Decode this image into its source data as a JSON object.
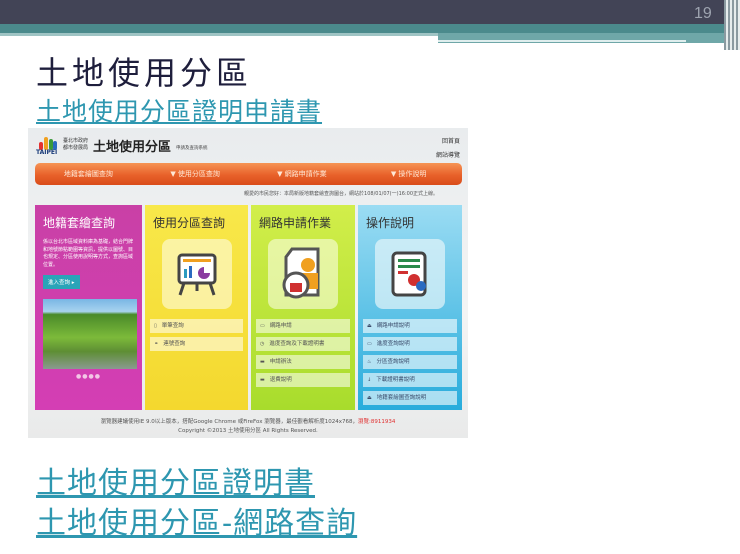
{
  "slide": {
    "page_number": "19",
    "title": "土地使用分區",
    "link_top": "土地使用分區證明申請書",
    "links_bottom": [
      "土地使用分區證明書",
      "土地使用分區-網路查詢"
    ]
  },
  "site": {
    "logo_text": "TAIPEI",
    "org_lines": [
      "臺北市政府",
      "都市發展局"
    ],
    "app_title": "土地使用分區",
    "app_subtitle": "申請及查詢系統",
    "top_links": [
      "回首頁",
      "網站導覽"
    ],
    "nav": [
      "地籍套繪圖查詢",
      "▼ 使用分區查詢",
      "▼ 網路申請作業",
      "▼ 操作說明"
    ],
    "notice": "親愛的市民您好：本局新版地籍套繪查詢圖台，網站於108/01/07(一)16:00正式上線。",
    "columns": [
      {
        "title": "地籍套繪查詢",
        "desc": "係以台北市區域資料庫為基礎，結合門牌和地號節點範圍等資訊，提供以圖號、目也規定、分區使用說明等方式，查詢區域位置。",
        "button": "進入查詢 ▸",
        "dots": "●●●●"
      },
      {
        "title": "使用分區查詢",
        "icon": "presentation-chart-icon",
        "items": [
          {
            "icon": "document-icon",
            "label": "單筆查詢"
          },
          {
            "icon": "link-icon",
            "label": "連號查詢"
          }
        ]
      },
      {
        "title": "網路申請作業",
        "icon": "user-lock-document-icon",
        "items": [
          {
            "icon": "monitor-icon",
            "label": "網路申請"
          },
          {
            "icon": "clock-icon",
            "label": "進度查詢及下載證明書"
          },
          {
            "icon": "chat-icon",
            "label": "申請辦法"
          },
          {
            "icon": "chat-icon",
            "label": "退費說明"
          }
        ]
      },
      {
        "title": "操作說明",
        "icon": "settings-document-icon",
        "items": [
          {
            "icon": "user-icon",
            "label": "網路申請說明"
          },
          {
            "icon": "card-icon",
            "label": "進度查詢說明"
          },
          {
            "icon": "fire-icon",
            "label": "分區查詢說明"
          },
          {
            "icon": "download-icon",
            "label": "下載證明書說明"
          },
          {
            "icon": "user-icon",
            "label": "地籍套繪圖查詢說明"
          }
        ]
      }
    ],
    "footer_line1": "瀏覽器建議使用IE 9.0以上版本，搭配Google Chrome 或FireFox 瀏覽器，最佳觀看解析度1024x768，",
    "footer_visits": "瀏覽:8911934",
    "footer_line2": "Copyright ©2013 土地使用分區 All Rights Reserved."
  }
}
